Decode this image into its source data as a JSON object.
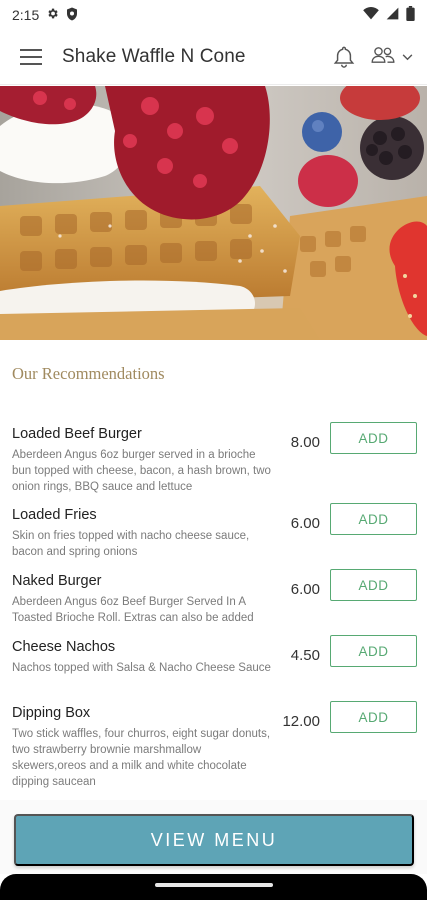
{
  "status_bar": {
    "time": "2:15",
    "icons": [
      "gear-icon",
      "shield-icon",
      "wifi-icon",
      "signal-icon",
      "battery-icon"
    ]
  },
  "app_bar": {
    "title": "Shake Waffle N Cone",
    "icons": [
      "hamburger-menu-icon",
      "bell-icon",
      "account-switch-icon",
      "chevron-down-icon"
    ]
  },
  "hero": {
    "image": "waffle-with-berries"
  },
  "recommendations": {
    "title": "Our Recommendations",
    "add_label": "ADD",
    "items": [
      {
        "name": "Loaded Beef Burger",
        "description": "Aberdeen Angus 6oz burger served in a brioche bun topped with cheese, bacon, a hash brown, two onion rings, BBQ sauce and lettuce",
        "price": "8.00"
      },
      {
        "name": "Loaded Fries",
        "description": "Skin on fries topped with nacho cheese sauce, bacon and spring onions",
        "price": "6.00"
      },
      {
        "name": "Naked Burger",
        "description": "Aberdeen Angus 6oz Beef Burger Served In A Toasted Brioche Roll. Extras can also be added",
        "price": "6.00"
      },
      {
        "name": "Cheese Nachos",
        "description": "Nachos topped with Salsa & Nacho Cheese Sauce",
        "price": "4.50"
      },
      {
        "name": "Dipping Box",
        "description": "Two stick waffles, four churros, eight sugar donuts, two strawberry brownie marshmallow skewers,oreos and a milk and white chocolate dipping saucean",
        "price": "12.00"
      }
    ]
  },
  "footer": {
    "view_menu_label": "VIEW MENU"
  },
  "colors": {
    "accent_gold": "#a08a5f",
    "add_green": "#57a973",
    "view_menu_teal": "#5ea4b6"
  }
}
